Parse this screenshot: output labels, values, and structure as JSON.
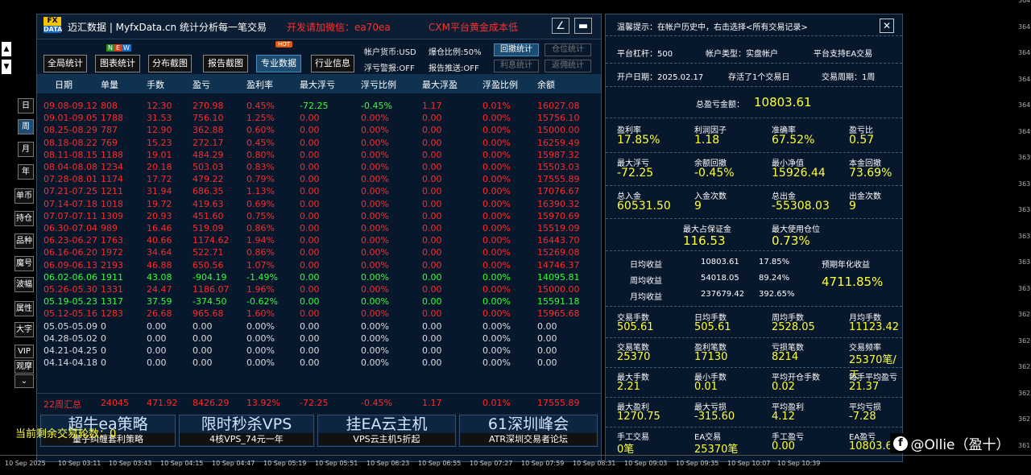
{
  "app": {
    "logo_top": "FX",
    "logo_bottom": "DATA",
    "title": "迈汇数据 | MyfxData.cn  统计分析每一笔交易",
    "wechat": "开发请加微信：ea70ea",
    "promo": "CXM平台黄金成本低",
    "minimize": "∠",
    "restore": "▬"
  },
  "toolbar": {
    "badge_new": "N E W",
    "badge_hot": "HOT",
    "buttons": [
      "全局统计",
      "图表统计",
      "分布截图",
      "报告截图",
      "专业数据",
      "行业信息"
    ],
    "active_index": 4,
    "info1": "帐户货币:USD",
    "info2": "爆仓比例:50%",
    "info3": "浮亏警报:OFF",
    "info4": "报告推送:OFF",
    "btn_rollback": "回撤统计",
    "btn_position": "仓位统计",
    "btn_interest": "利息统计",
    "btn_rebate": "返佣统计"
  },
  "table": {
    "headers": [
      "日期",
      "单量",
      "手数",
      "盈亏",
      "盈利率",
      "最大浮亏",
      "浮亏比例",
      "最大浮盈",
      "浮盈比例",
      "余额"
    ],
    "rows": [
      {
        "c": [
          "09.08-09.12",
          "808",
          "12.30",
          "270.98",
          "0.45%",
          "-72.25",
          "-0.45%",
          "1.17",
          "0.01%",
          "16027.08"
        ],
        "color": "red",
        "mixed": true
      },
      {
        "c": [
          "09.01-09.05",
          "1788",
          "31.53",
          "756.10",
          "1.25%",
          "0.00",
          "0.00%",
          "0.00",
          "0.00%",
          "15756.10"
        ],
        "color": "red"
      },
      {
        "c": [
          "08.25-08.29",
          "787",
          "12.90",
          "362.88",
          "0.60%",
          "0.00",
          "0.00%",
          "0.00",
          "0.00%",
          "15000.00"
        ],
        "color": "red"
      },
      {
        "c": [
          "08.18-08.22",
          "769",
          "15.23",
          "272.17",
          "0.45%",
          "0.00",
          "0.00%",
          "0.00",
          "0.00%",
          "16259.49"
        ],
        "color": "red"
      },
      {
        "c": [
          "08.11-08.15",
          "1188",
          "19.01",
          "484.29",
          "0.80%",
          "0.00",
          "0.00%",
          "0.00",
          "0.00%",
          "15987.32"
        ],
        "color": "red"
      },
      {
        "c": [
          "08.04-08.08",
          "1234",
          "20.18",
          "503.03",
          "0.83%",
          "0.00",
          "0.00%",
          "0.00",
          "0.00%",
          "15503.03"
        ],
        "color": "red"
      },
      {
        "c": [
          "07.28-08.01",
          "1174",
          "17.72",
          "479.22",
          "0.79%",
          "0.00",
          "0.00%",
          "0.00",
          "0.00%",
          "17555.89"
        ],
        "color": "red"
      },
      {
        "c": [
          "07.21-07.25",
          "1211",
          "31.94",
          "686.35",
          "1.13%",
          "0.00",
          "0.00%",
          "0.00",
          "0.00%",
          "17076.67"
        ],
        "color": "red"
      },
      {
        "c": [
          "07.14-07.18",
          "1018",
          "19.72",
          "419.63",
          "0.69%",
          "0.00",
          "0.00%",
          "0.00",
          "0.00%",
          "16390.32"
        ],
        "color": "red"
      },
      {
        "c": [
          "07.07-07.11",
          "1309",
          "20.93",
          "451.60",
          "0.75%",
          "0.00",
          "0.00%",
          "0.00",
          "0.00%",
          "15970.69"
        ],
        "color": "red"
      },
      {
        "c": [
          "06.30-07.04",
          "989",
          "16.46",
          "519.09",
          "0.86%",
          "0.00",
          "0.00%",
          "0.00",
          "0.00%",
          "15519.09"
        ],
        "color": "red"
      },
      {
        "c": [
          "06.23-06.27",
          "1763",
          "40.66",
          "1174.62",
          "1.94%",
          "0.00",
          "0.00%",
          "0.00",
          "0.00%",
          "16443.70"
        ],
        "color": "red"
      },
      {
        "c": [
          "06.16-06.20",
          "1972",
          "34.64",
          "522.71",
          "0.86%",
          "0.00",
          "0.00%",
          "0.00",
          "0.00%",
          "15269.08"
        ],
        "color": "red"
      },
      {
        "c": [
          "06.09-06.13",
          "2193",
          "46.88",
          "650.56",
          "1.07%",
          "0.00",
          "0.00%",
          "0.00",
          "0.00%",
          "14746.37"
        ],
        "color": "red"
      },
      {
        "c": [
          "06.02-06.06",
          "1911",
          "43.08",
          "-904.19",
          "-1.49%",
          "0.00",
          "0.00%",
          "0.00",
          "0.00%",
          "14095.81"
        ],
        "color": "green"
      },
      {
        "c": [
          "05.26-05.30",
          "1331",
          "24.47",
          "1186.07",
          "1.96%",
          "0.00",
          "0.00%",
          "0.00",
          "0.00%",
          "15000.00"
        ],
        "color": "red"
      },
      {
        "c": [
          "05.19-05.23",
          "1317",
          "37.59",
          "-374.50",
          "-0.62%",
          "0.00",
          "0.00%",
          "0.00",
          "0.00%",
          "15591.18"
        ],
        "color": "green"
      },
      {
        "c": [
          "05.12-05.16",
          "1283",
          "26.68",
          "965.68",
          "1.60%",
          "0.00",
          "0.00%",
          "0.00",
          "0.00%",
          "15965.68"
        ],
        "color": "red"
      },
      {
        "c": [
          "05.05-05.09",
          "0",
          "0.00",
          "0.00",
          "0.00%",
          "0.00",
          "0.00%",
          "0.00",
          "0.00%",
          "0.00"
        ],
        "color": "white"
      },
      {
        "c": [
          "04.28-05.02",
          "0",
          "0.00",
          "0.00",
          "0.00%",
          "0.00",
          "0.00%",
          "0.00",
          "0.00%",
          "0.00"
        ],
        "color": "white"
      },
      {
        "c": [
          "04.21-04.25",
          "0",
          "0.00",
          "0.00",
          "0.00%",
          "0.00",
          "0.00%",
          "0.00",
          "0.00%",
          "0.00"
        ],
        "color": "white"
      },
      {
        "c": [
          "04.14-04.18",
          "0",
          "0.00",
          "0.00",
          "0.00%",
          "0.00",
          "0.00%",
          "0.00",
          "0.00%",
          "0.00"
        ],
        "color": "white"
      }
    ],
    "summary": [
      "22周汇总",
      "24045",
      "471.92",
      "8426.29",
      "13.92%",
      "-72.25",
      "-0.45%",
      "1.17",
      "0.01%",
      "17555.89"
    ]
  },
  "side_buttons": [
    "日",
    "周",
    "月",
    "年",
    "单币",
    "持仓",
    "品种",
    "魔号",
    "波幅",
    "属性",
    "大字",
    "VIP",
    "观摩",
    "⌄"
  ],
  "side_active": 1,
  "ads": [
    {
      "title": "超牛ea策略",
      "sub": "量子纠缠套利策略"
    },
    {
      "title": "限时秒杀VPS",
      "sub": "4核VPS_74元一年"
    },
    {
      "title": "挂EA云主机",
      "sub": "VPS云主机5折起"
    },
    {
      "title": "61深圳峰会",
      "sub": "ATR深圳交易者论坛"
    }
  ],
  "overlay_text": "当前剩余交易轮数：0",
  "right": {
    "tip": "温馨提示：在帐户历史中，右击选择<所有交易记录>",
    "close": "✕",
    "leverage": "平台杠杆：500",
    "acct_type": "帐户类型：实盘帐户",
    "ea_support": "平台支持EA交易",
    "open_date": "开户日期：2025.02.17",
    "days": "存活了1个交易日",
    "cycle": "交易周期：1周",
    "total_label": "总盈亏金额：",
    "total_value": "10803.61",
    "grid1": [
      {
        "l": "盈利率",
        "v": "17.85%"
      },
      {
        "l": "利润因子",
        "v": "1.18"
      },
      {
        "l": "准确率",
        "v": "67.52%"
      },
      {
        "l": "盈亏比",
        "v": "0.57"
      },
      {
        "l": "最大浮亏",
        "v": "-72.25"
      },
      {
        "l": "余额回撤",
        "v": "-0.45%"
      },
      {
        "l": "最小净值",
        "v": "15926.44"
      },
      {
        "l": "本金回撤",
        "v": "73.69%"
      },
      {
        "l": "总入金",
        "v": "60531.50"
      },
      {
        "l": "入金次数",
        "v": "9"
      },
      {
        "l": "总出金",
        "v": "-55308.03"
      },
      {
        "l": "出金次数",
        "v": "9"
      }
    ],
    "margin_label": "最大占保证金",
    "margin_value": "116.53",
    "maxpos_label": "最大使用仓位",
    "maxpos_value": "0.73%",
    "daily_label": "日均收益",
    "daily_v1": "10803.61",
    "daily_v2": "17.85%",
    "weekly_label": "周均收益",
    "weekly_v1": "54018.05",
    "weekly_v2": "89.24%",
    "monthly_label": "月均收益",
    "monthly_v1": "237679.42",
    "monthly_v2": "392.65%",
    "annual_label": "预期年化收益",
    "annual_value": "4711.85%",
    "grid2": [
      {
        "l": "交易手数",
        "v": "505.61"
      },
      {
        "l": "日均手数",
        "v": "505.61"
      },
      {
        "l": "周均手数",
        "v": "2528.05"
      },
      {
        "l": "月均手数",
        "v": "11123.42"
      },
      {
        "l": "交易笔数",
        "v": "25370"
      },
      {
        "l": "盈利笔数",
        "v": "17130"
      },
      {
        "l": "亏损笔数",
        "v": "8214"
      },
      {
        "l": "交易频率",
        "v": "25370笔/天"
      },
      {
        "l": "最大手数",
        "v": "2.21"
      },
      {
        "l": "最小手数",
        "v": "0.01"
      },
      {
        "l": "平均开仓手数",
        "v": "0.02"
      },
      {
        "l": "每手平均盈亏",
        "v": "21.37"
      },
      {
        "l": "最大盈利",
        "v": "1270.75"
      },
      {
        "l": "最大亏损",
        "v": "-315.60"
      },
      {
        "l": "平均盈利",
        "v": "4.12"
      },
      {
        "l": "平均亏损",
        "v": "-7.28"
      },
      {
        "l": "手工交易",
        "v": "0笔"
      },
      {
        "l": "EA交易",
        "v": "25370笔"
      },
      {
        "l": "手工盈亏",
        "v": "0.00"
      },
      {
        "l": "EA盈亏",
        "v": "10803.6"
      }
    ]
  },
  "watermark": "@Ollie（盈十）",
  "time_axis": [
    "10 Sep 2025",
    "10 Sep 03:11",
    "10 Sep 03:43",
    "10 Sep 04:15",
    "10 Sep 04:47",
    "10 Sep 05:19",
    "10 Sep 05:51",
    "10 Sep 06:23",
    "10 Sep 06:55",
    "10 Sep 07:27",
    "10 Sep 07:59",
    "10 Sep 08:31",
    "10 Sep 09:03",
    "10 Sep 09:35",
    "10 Sep 10:07",
    "10 Sep 10:39"
  ],
  "price_axis": [
    "3649",
    "3648",
    "3646",
    "3644",
    "3642",
    "3640",
    "3639",
    "3637",
    "3635",
    "3633",
    "3631",
    "3630",
    "3628",
    "3626",
    "3625",
    "3623",
    "3621",
    "3619"
  ],
  "colors": {
    "panel_bg": "#07182c",
    "header_bg": "#0e3250",
    "profit": "#ff2a2a",
    "loss": "#33ff33",
    "accent": "#ffff33"
  }
}
